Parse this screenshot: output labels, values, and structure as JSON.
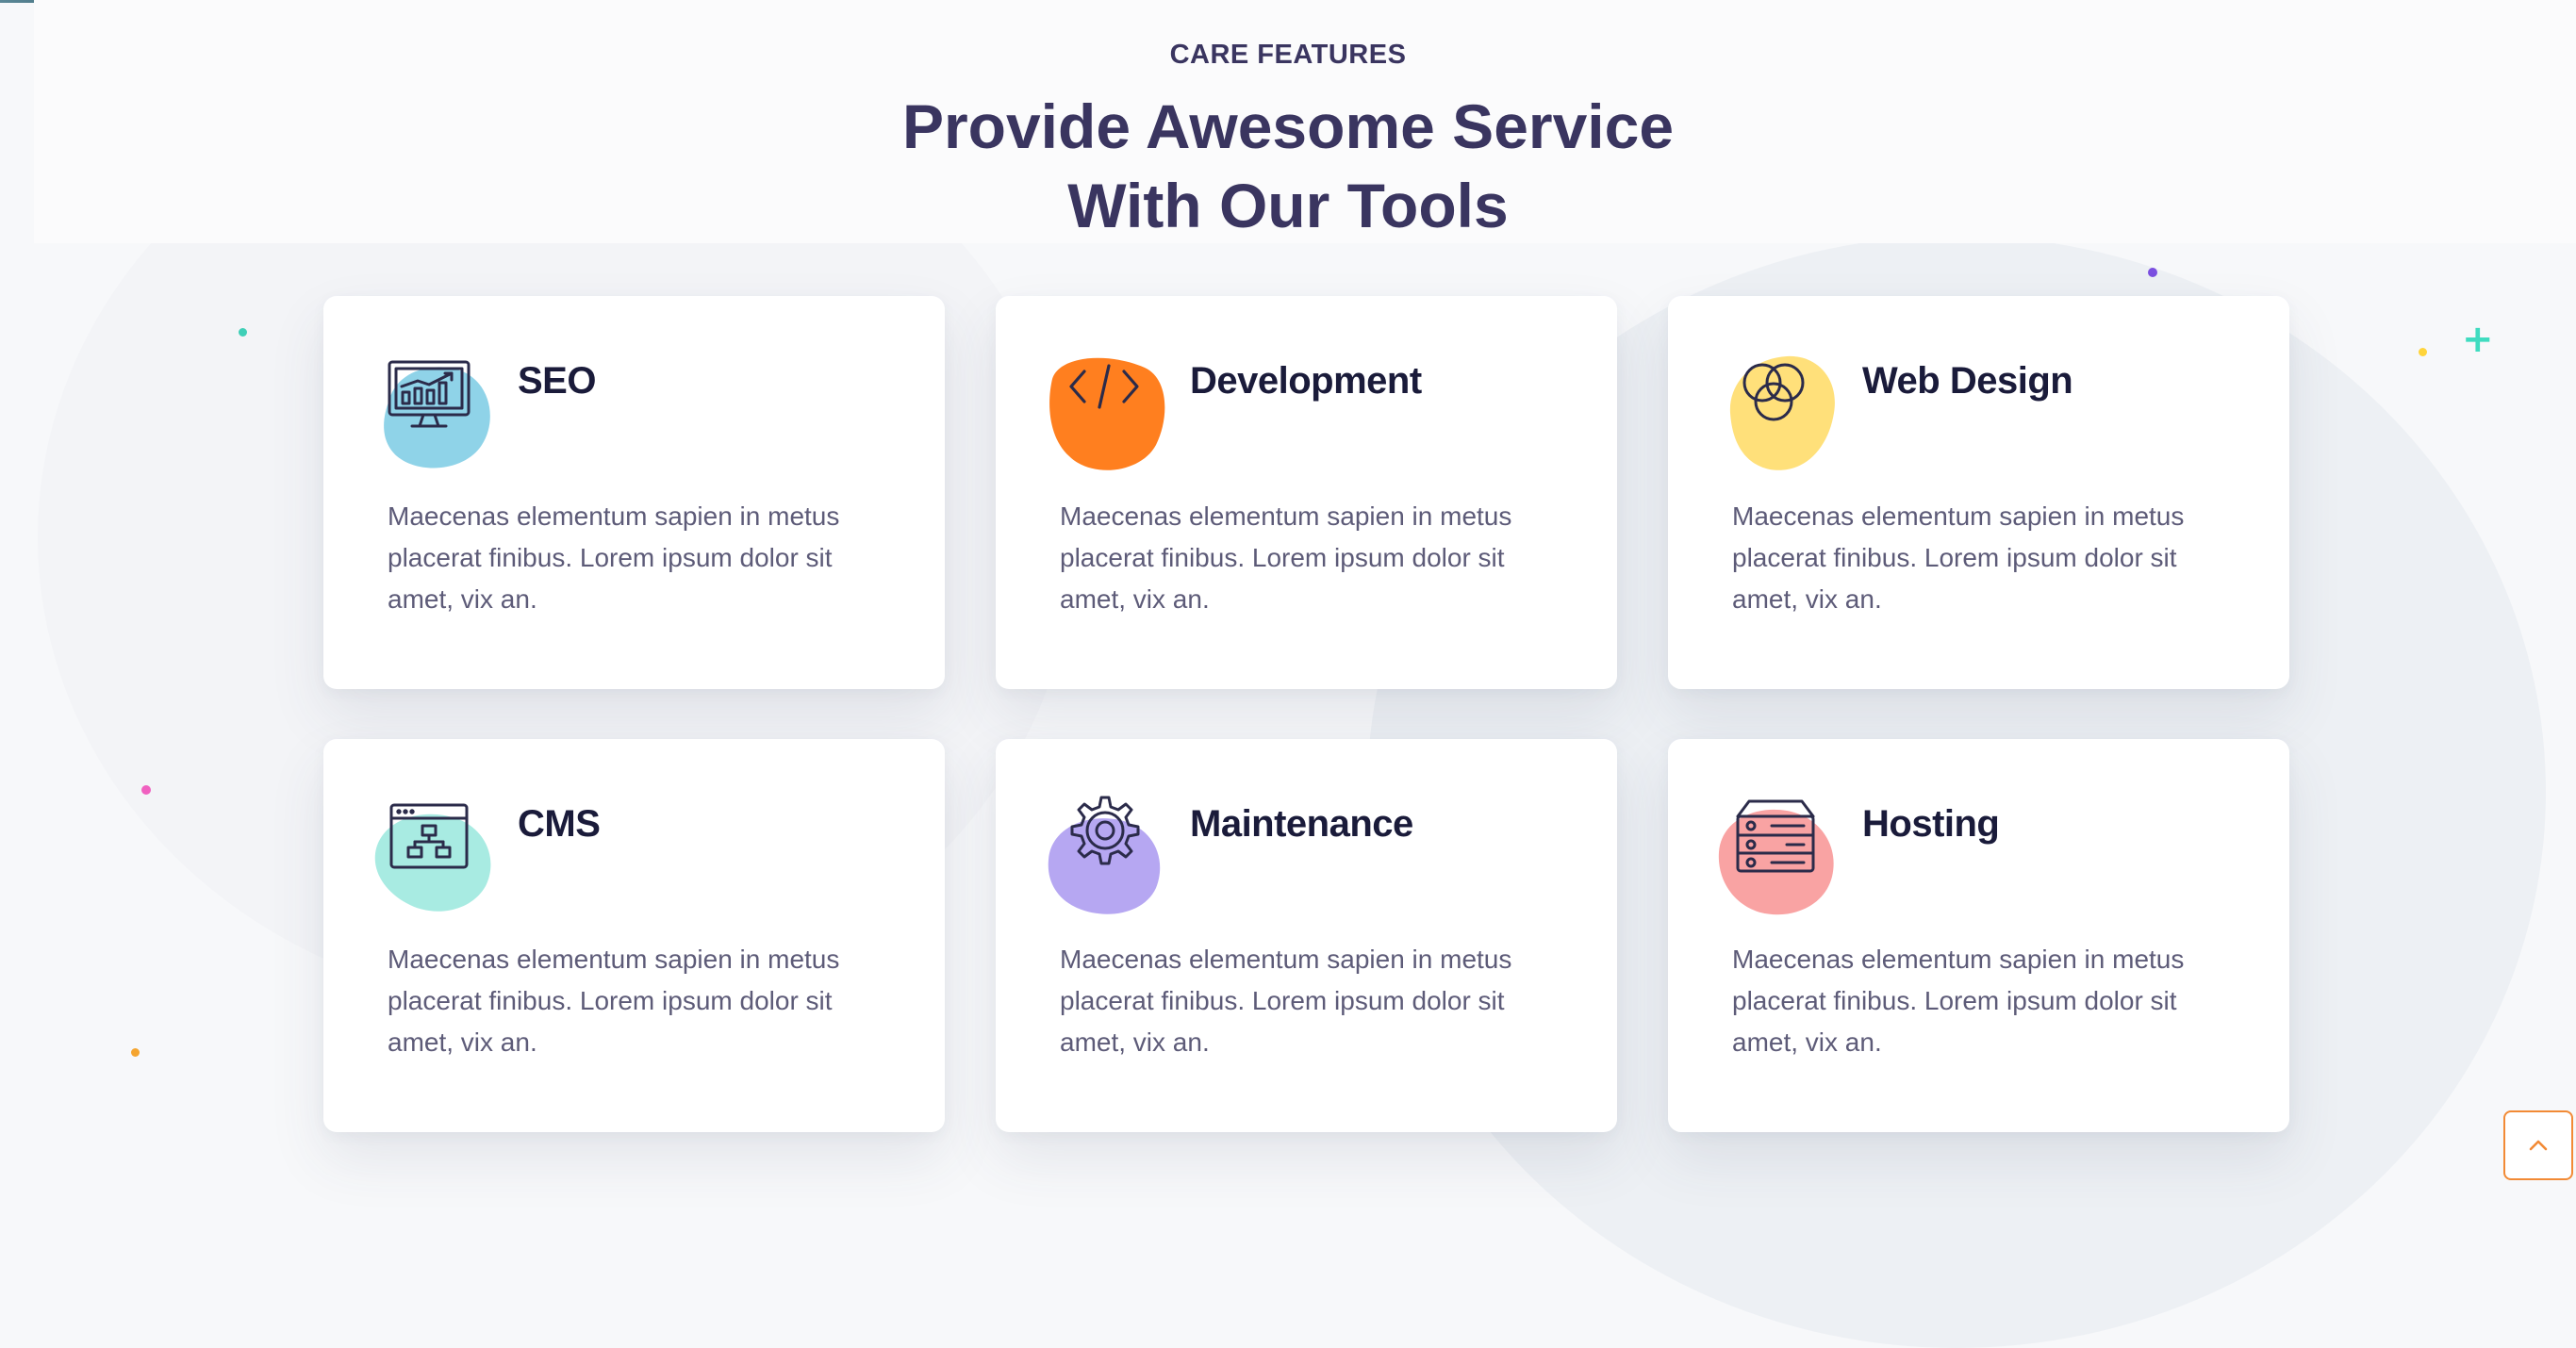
{
  "section": {
    "eyebrow": "CARE FEATURES",
    "heading_line1": "Provide Awesome Service",
    "heading_line2": "With Our Tools"
  },
  "features": [
    {
      "title": "SEO",
      "icon": "seo-monitor-icon",
      "blob_color": "#8fd3e8",
      "description": "Maecenas elementum sapien in metus placerat finibus. Lorem ipsum dolor sit amet, vix an."
    },
    {
      "title": "Development",
      "icon": "code-icon",
      "blob_color": "#ff7f1f",
      "description": "Maecenas elementum sapien in metus placerat finibus. Lorem ipsum dolor sit amet, vix an."
    },
    {
      "title": "Web Design",
      "icon": "venn-circles-icon",
      "blob_color": "#ffe07a",
      "description": "Maecenas elementum sapien in metus placerat finibus. Lorem ipsum dolor sit amet, vix an."
    },
    {
      "title": "CMS",
      "icon": "cms-window-icon",
      "blob_color": "#a8ebe2",
      "description": "Maecenas elementum sapien in metus placerat finibus. Lorem ipsum dolor sit amet, vix an."
    },
    {
      "title": "Maintenance",
      "icon": "gear-icon",
      "blob_color": "#b6a7f2",
      "description": "Maecenas elementum sapien in metus placerat finibus. Lorem ipsum dolor sit amet, vix an."
    },
    {
      "title": "Hosting",
      "icon": "server-icon",
      "blob_color": "#f9a3a3",
      "description": "Maecenas elementum sapien in metus placerat finibus. Lorem ipsum dolor sit amet, vix an."
    }
  ],
  "colors": {
    "heading": "#3a3560",
    "scroll_top_border": "#f28a35"
  },
  "scroll_top": {
    "icon": "chevron-up-icon"
  }
}
